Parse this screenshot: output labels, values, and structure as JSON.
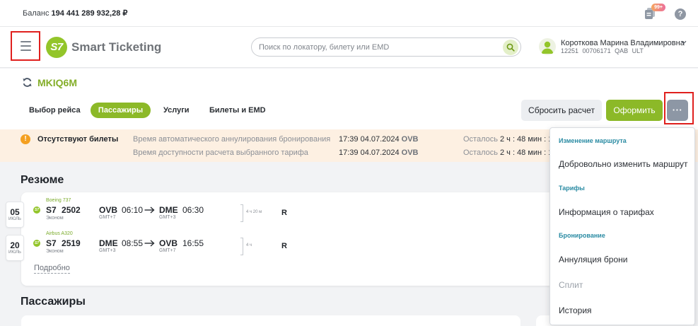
{
  "topbar": {
    "balance_label": "Баланс",
    "balance_value": "194 441 289 932,28 ₽",
    "notifications_icon": "documents-stack-icon",
    "notifications_badge": "99+",
    "help_glyph": "?"
  },
  "header": {
    "menu_icon": "hamburger-icon",
    "logo_text": "S7",
    "brand_name": "Smart Ticketing",
    "search": {
      "placeholder": "Поиск по локатору, билету или EMD",
      "value": "",
      "icon": "search-icon"
    },
    "user": {
      "name": "Короткова Марина Владимировна",
      "details": "12251 00706171 QAB ULT",
      "avatar_icon": "person-icon"
    }
  },
  "booking": {
    "pnr": "MKIQ6M",
    "tabs": [
      "Выбор рейса",
      "Пассажиры",
      "Услуги",
      "Билеты и EMD"
    ],
    "active_tab_index": 1,
    "actions": {
      "reset": "Сбросить расчет",
      "issue": "Оформить",
      "more": "···"
    }
  },
  "alert": {
    "icon": "exclamation-circle-icon",
    "glyph": "!",
    "title": "Отсутствуют билеты",
    "rows": [
      {
        "label": "Время автоматического аннулирования бронирования",
        "datetime": "17:39 04.07.2024",
        "airport": "OVB",
        "remaining_label": "Осталось",
        "remaining": "2 ч : 48 мин : 1"
      },
      {
        "label": "Время доступности расчета выбранного тарифа",
        "datetime": "17:39 04.07.2024",
        "airport": "OVB",
        "remaining_label": "Осталось",
        "remaining": "2 ч : 48 мин : 1"
      }
    ]
  },
  "summary": {
    "title": "Резюме",
    "flights": [
      {
        "day": "05",
        "month": "ИЮЛЬ",
        "aircraft": "Boeing 737",
        "airline": "S7",
        "number": "2502",
        "cabin": "Эконом",
        "from": "OVB",
        "dep_time": "06:10",
        "from_tz": "GMT+7",
        "to": "DME",
        "arr_time": "06:30",
        "to_tz": "GMT+3",
        "duration": "4 ч 20 м",
        "booking_class": "R"
      },
      {
        "day": "20",
        "month": "ИЮЛЬ",
        "aircraft": "Airbus A320",
        "airline": "S7",
        "number": "2519",
        "cabin": "Эконом",
        "from": "DME",
        "dep_time": "08:55",
        "from_tz": "GMT+3",
        "to": "OVB",
        "arr_time": "16:55",
        "to_tz": "GMT+7",
        "duration": "4 ч",
        "booking_class": "R"
      }
    ],
    "details_link": "Подробно"
  },
  "passengers": {
    "title": "Пассажиры"
  },
  "more_menu": {
    "sections": [
      {
        "title": "Изменение маршрута",
        "items": [
          {
            "label": "Добровольно изменить маршрут",
            "enabled": true
          }
        ]
      },
      {
        "title": "Тарифы",
        "items": [
          {
            "label": "Информация о тарифах",
            "enabled": true
          }
        ]
      },
      {
        "title": "Бронирование",
        "items": [
          {
            "label": "Аннуляция брони",
            "enabled": true
          },
          {
            "label": "Сплит",
            "enabled": false
          },
          {
            "label": "История",
            "enabled": true
          }
        ]
      }
    ]
  },
  "colors": {
    "accent": "#8cb928",
    "alert_background": "#fdf0e2",
    "alert_icon": "#f4a020",
    "menu_section_title": "#2a8ba3",
    "highlight_outline": "#e0201e"
  }
}
